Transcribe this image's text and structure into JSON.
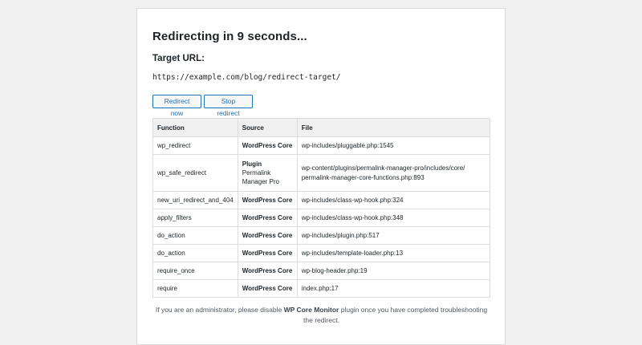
{
  "page": {
    "title": "Redirecting in 9 seconds...",
    "target_label": "Target URL:",
    "target_url": "https://example.com/blog/redirect-target/"
  },
  "buttons": {
    "redirect_now": "Redirect now",
    "stop_redirect": "Stop redirect"
  },
  "table": {
    "headers": [
      "Function",
      "Source",
      "File"
    ],
    "rows": [
      {
        "function": "wp_redirect",
        "source": "WordPress Core",
        "file": "wp-includes/pluggable.php:1545"
      },
      {
        "function": "wp_safe_redirect",
        "source_label": "Plugin",
        "source_name_1": "Permalink",
        "source_name_2": "Manager Pro",
        "file_1": "wp-content/plugins/permalink-manager-pro/includes/core/",
        "file_2": "permalink-manager-core-functions.php:893"
      },
      {
        "function": "new_uri_redirect_and_404",
        "source": "WordPress Core",
        "file": "wp-includes/class-wp-hook.php:324"
      },
      {
        "function": "apply_filters",
        "source": "WordPress Core",
        "file": "wp-includes/class-wp-hook.php:348"
      },
      {
        "function": "do_action",
        "source": "WordPress Core",
        "file": "wp-includes/plugin.php:517"
      },
      {
        "function": "do_action",
        "source": "WordPress Core",
        "file": "wp-includes/template-loader.php:13"
      },
      {
        "function": "require_once",
        "source": "WordPress Core",
        "file": "wp-blog-header.php:19"
      },
      {
        "function": "require",
        "source": "WordPress Core",
        "file": "index.php:17"
      }
    ]
  },
  "footer": {
    "prefix": "If you are an administrator, please disable ",
    "plugin_name": "WP Core Monitor",
    "suffix": " plugin once you have completed troubleshooting the redirect."
  },
  "colors": {
    "accent": "#2271b1",
    "background": "#f0f0f1",
    "panel": "#ffffff",
    "border": "#dcdcde"
  }
}
